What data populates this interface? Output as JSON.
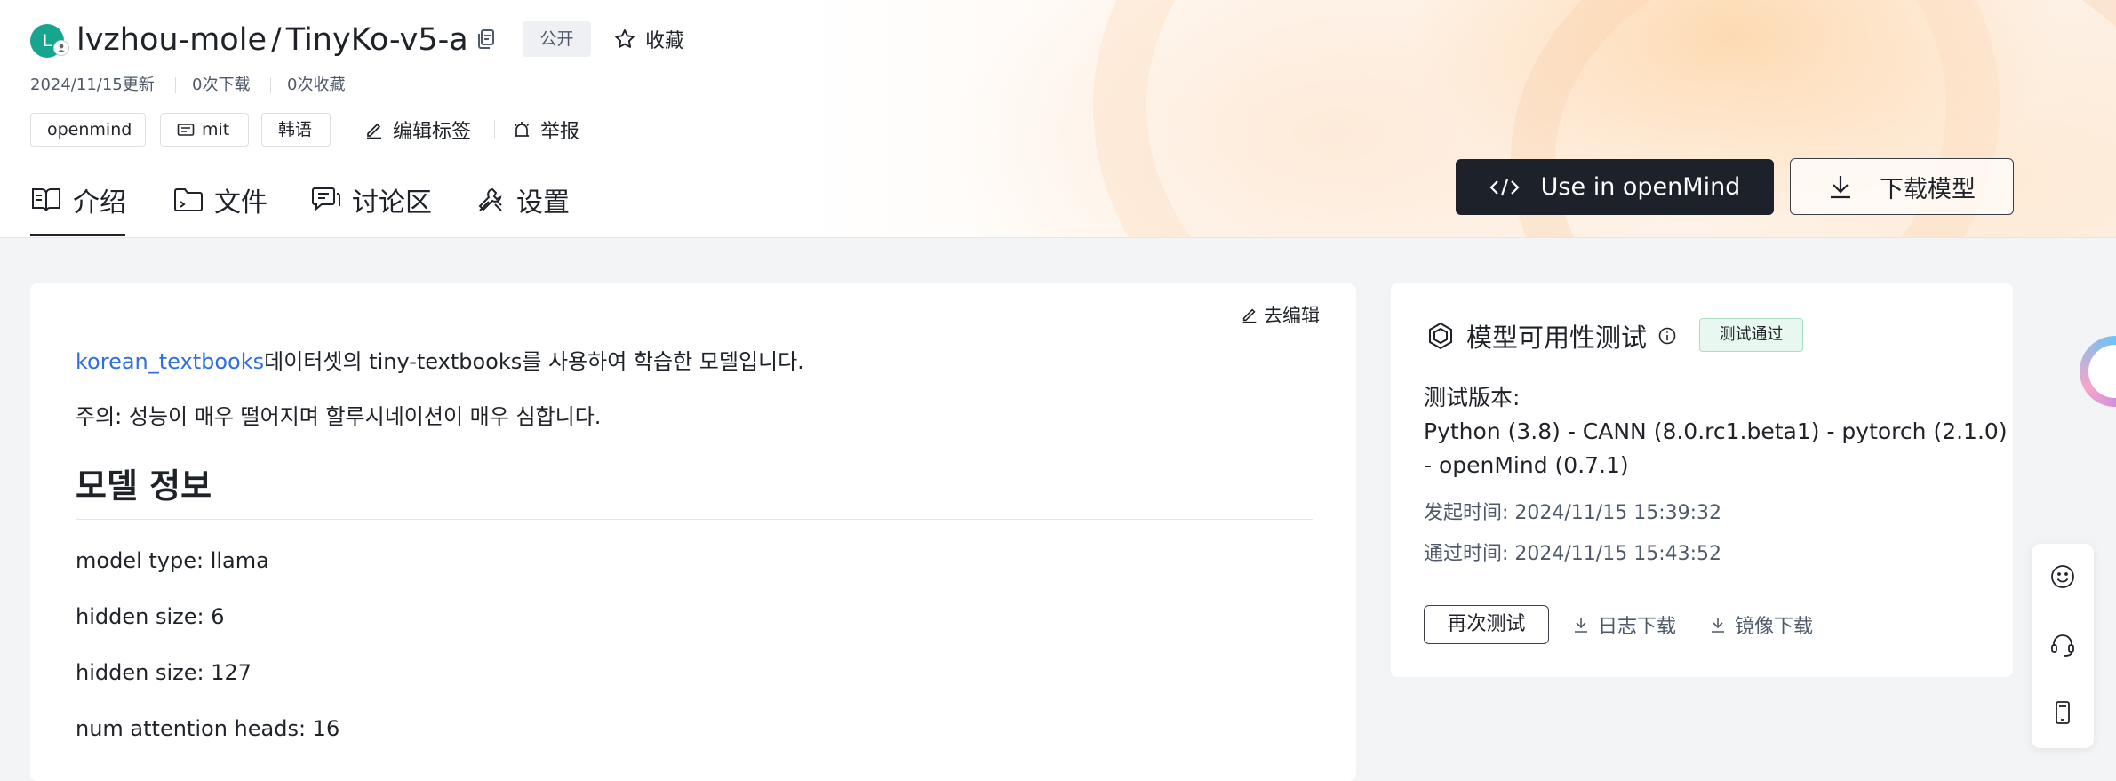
{
  "repo": {
    "avatar_letter": "L",
    "owner": "lvzhou-mole",
    "separator": "/",
    "name": "TinyKo-v5-a",
    "visibility": "公开",
    "favorite_label": "收藏",
    "updated": "2024/11/15更新",
    "downloads": "0次下载",
    "favorites": "0次收藏"
  },
  "tags": [
    "openmind",
    "mit",
    "韩语"
  ],
  "tools": {
    "edit_tags": "编辑标签",
    "report": "举报"
  },
  "tabs": [
    {
      "label": "介绍",
      "icon": "book-icon",
      "active": true
    },
    {
      "label": "文件",
      "icon": "folder-icon",
      "active": false
    },
    {
      "label": "讨论区",
      "icon": "discussion-icon",
      "active": false
    },
    {
      "label": "设置",
      "icon": "settings-icon",
      "active": false
    }
  ],
  "actions": {
    "use_in": "Use in openMind",
    "download_model": "下载模型"
  },
  "readme": {
    "edit": "去编辑",
    "link_text": "korean_textbooks",
    "intro_rest": "데이터셋의 tiny-textbooks를 사용하여 학습한 모델입니다.",
    "warning": "주의: 성능이 매우 떨어지며 할루시네이션이 매우 심합니다.",
    "heading": "모델 정보",
    "items": [
      "model type: llama",
      "hidden size: 6",
      "hidden size: 127",
      "num attention heads: 16"
    ]
  },
  "availability": {
    "title": "模型可用性测试",
    "status": "测试通过",
    "version_label": "测试版本:",
    "version_line1": "Python (3.8) - CANN (8.0.rc1.beta1) - pytorch (2.1.0)",
    "version_line2": "- openMind (0.7.1)",
    "start_time": "发起时间:  2024/11/15 15:39:32",
    "pass_time": "通过时间:  2024/11/15 15:43:52",
    "retest": "再次测试",
    "log_download": "日志下载",
    "image_download": "镜像下载"
  },
  "colors": {
    "accent_link": "#2f6fe0",
    "avatar": "#17a58f",
    "primary_button": "#1d2129",
    "pass_badge_bg": "#e8f7ef"
  }
}
